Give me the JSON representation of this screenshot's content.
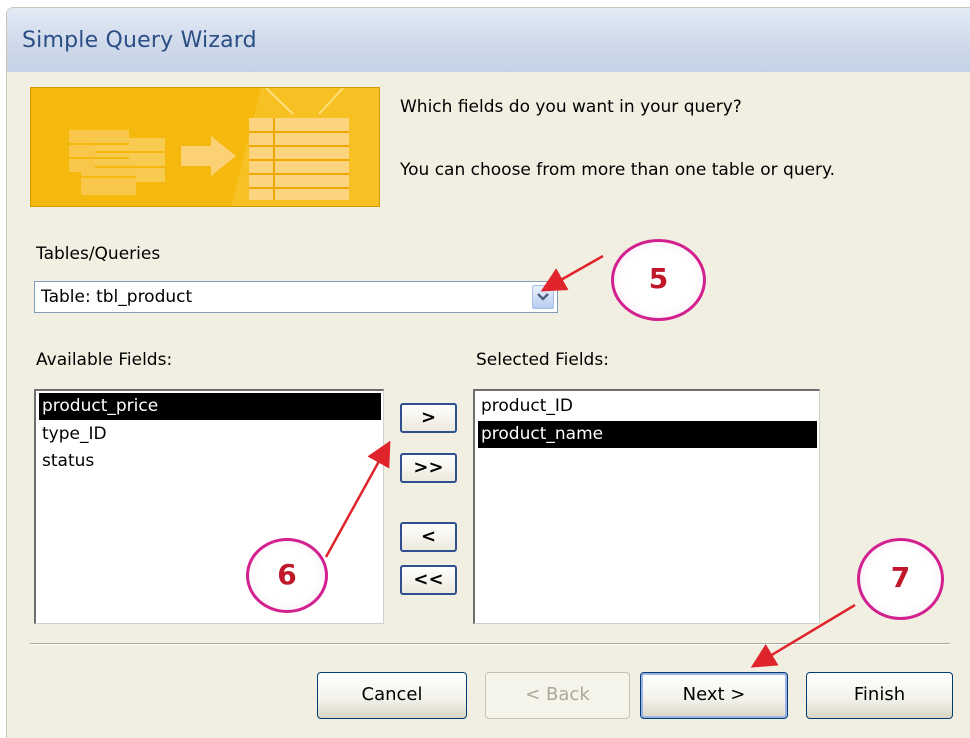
{
  "window": {
    "title": "Simple Query Wizard"
  },
  "intro": {
    "line1": "Which fields do you want in your query?",
    "line2": "You can choose from more than one table or query."
  },
  "tables_queries": {
    "label": "Tables/Queries",
    "value": "Table: tbl_product"
  },
  "available": {
    "label": "Available Fields:",
    "items": [
      "product_price",
      "type_ID",
      "status"
    ],
    "selected_index": 0
  },
  "selected": {
    "label": "Selected Fields:",
    "items": [
      "product_ID",
      "product_name"
    ],
    "selected_index": 1
  },
  "move_buttons": {
    "add_one": ">",
    "add_all": ">>",
    "remove_one": "<",
    "remove_all": "<<"
  },
  "buttons": {
    "cancel": "Cancel",
    "back": "< Back",
    "next": "Next >",
    "finish": "Finish"
  },
  "callouts": {
    "c5": "5",
    "c6": "6",
    "c7": "7"
  },
  "colors": {
    "callout_ring": "#d3208f",
    "arrow": "#e0242c",
    "banner": "#f5b80c",
    "title_text": "#2c4e86"
  }
}
